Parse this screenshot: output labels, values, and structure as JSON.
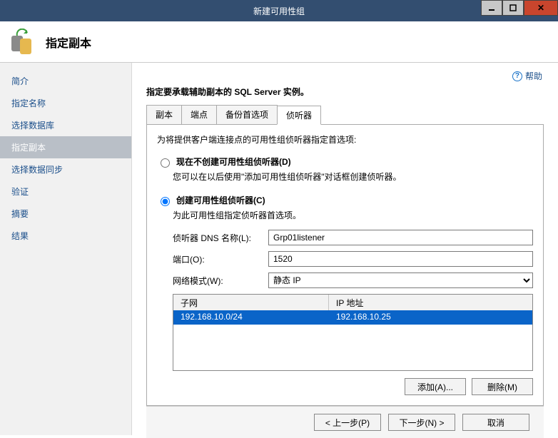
{
  "window": {
    "title": "新建可用性组"
  },
  "header": {
    "title": "指定副本"
  },
  "help": {
    "label": "帮助"
  },
  "sidebar": {
    "items": [
      {
        "label": "简介"
      },
      {
        "label": "指定名称"
      },
      {
        "label": "选择数据库"
      },
      {
        "label": "指定副本"
      },
      {
        "label": "选择数据同步"
      },
      {
        "label": "验证"
      },
      {
        "label": "摘要"
      },
      {
        "label": "结果"
      }
    ],
    "active_index": 3
  },
  "main": {
    "instruction": "指定要承载辅助副本的 SQL Server 实例。",
    "tabs": [
      "副本",
      "端点",
      "备份首选项",
      "侦听器"
    ],
    "active_tab": 3,
    "listener": {
      "intro": "为将提供客户端连接点的可用性组侦听器指定首选项:",
      "radio_dont_create": "现在不创建可用性组侦听器(D)",
      "radio_dont_create_sub": "您可以在以后使用\"添加可用性组侦听器\"对话框创建侦听器。",
      "radio_create": "创建可用性组侦听器(C)",
      "radio_create_sub": "为此可用性组指定侦听器首选项。",
      "selected": "create",
      "dns_label": "侦听器 DNS 名称(L):",
      "dns_value": "Grp01listener",
      "port_label": "端口(O):",
      "port_value": "1520",
      "mode_label": "网络模式(W):",
      "mode_value": "静态 IP",
      "grid": {
        "col_subnet": "子网",
        "col_ip": "IP 地址",
        "rows": [
          {
            "subnet": "192.168.10.0/24",
            "ip": "192.168.10.25"
          }
        ]
      },
      "add_btn": "添加(A)...",
      "del_btn": "删除(M)"
    }
  },
  "footer": {
    "prev": "< 上一步(P)",
    "next": "下一步(N) >",
    "cancel": "取消"
  }
}
